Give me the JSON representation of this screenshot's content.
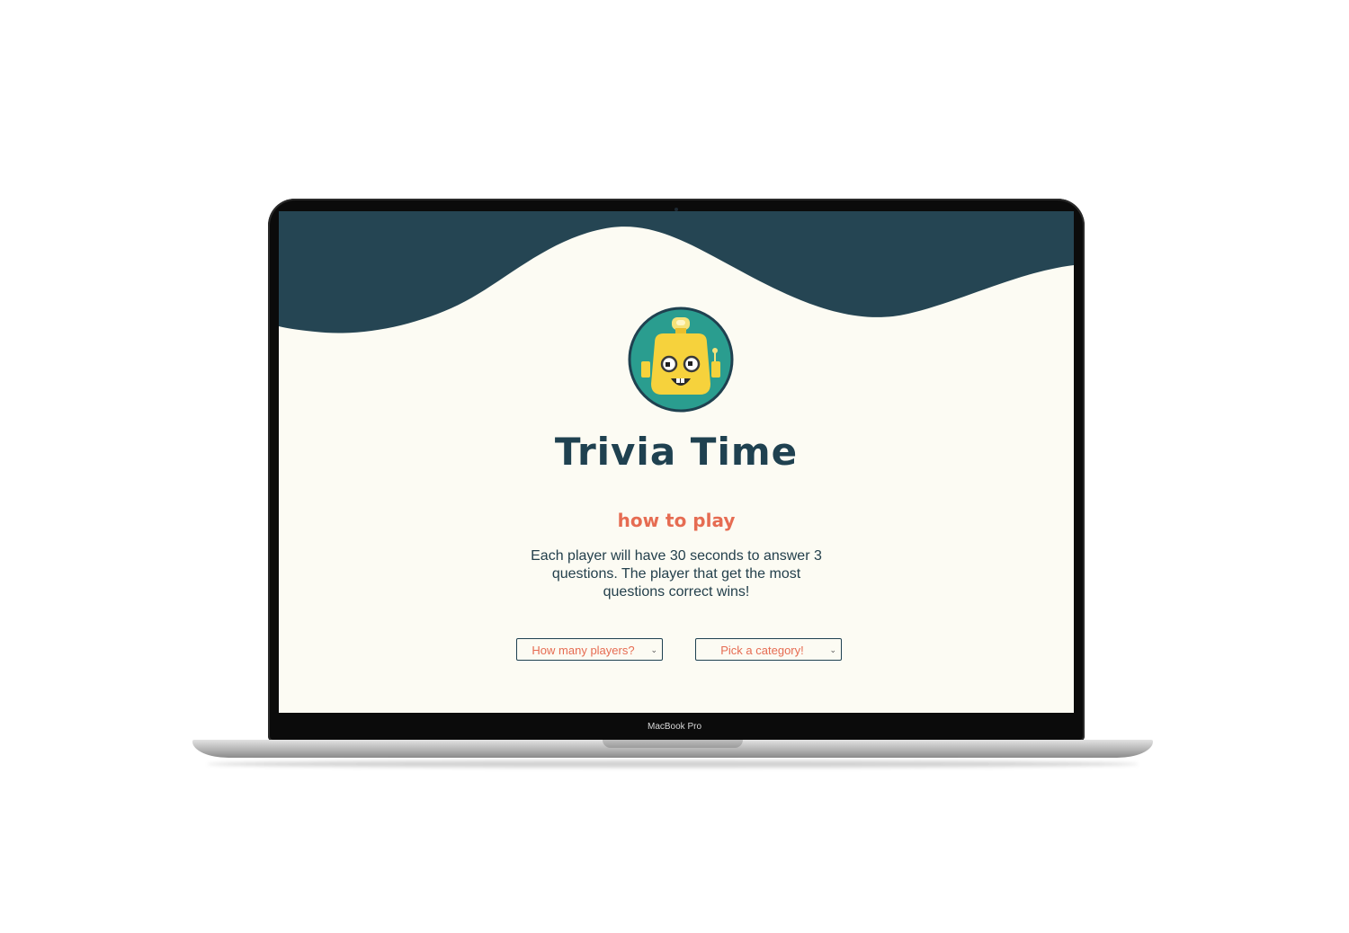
{
  "app": {
    "title": "Trivia Time",
    "subtitle": "how to play",
    "description": "Each player will have 30 seconds to answer 3 questions. The player that get the most questions correct wins!"
  },
  "controls": {
    "players_select": {
      "selected": "How many players?"
    },
    "category_select": {
      "selected": "Pick a category!"
    }
  },
  "device": {
    "label": "MacBook Pro"
  },
  "colors": {
    "header_wave": "#254553",
    "background": "#fcfbf3",
    "title": "#1f4150",
    "accent": "#e66c52",
    "logo_circle": "#2a9d8f",
    "robot": "#f6d23c"
  },
  "icons": {
    "logo": "robot-logo-icon",
    "dropdown": "chevron-down-icon"
  }
}
